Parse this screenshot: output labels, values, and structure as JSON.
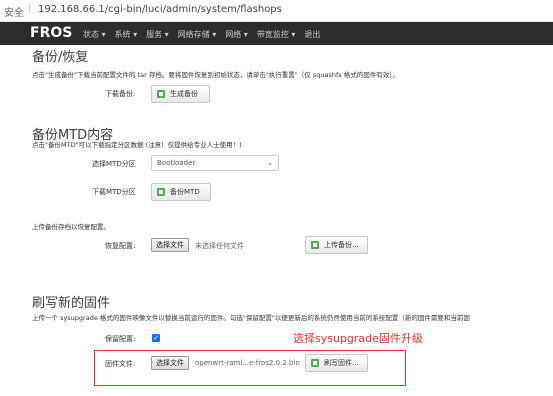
{
  "browser": {
    "security": "安全",
    "url": "192.168.66.1/cgi-bin/luci/admin/system/flashops"
  },
  "nav": {
    "brand": "FROS",
    "items": [
      "状态 ▾",
      "系统 ▾",
      "服务 ▾",
      "网络存储 ▾",
      "网络 ▾",
      "带宽监控 ▾",
      "退出"
    ]
  },
  "backup": {
    "title": "备份/恢复",
    "desc": "点击\"生成备份\"下载当前配置文件的 tar 存档。要将固件恢复到初始状态，请单击\"执行重置\"（仅 squashfs 格式的固件有效）。",
    "download_label": "下载备份:",
    "generate_btn": "生成备份"
  },
  "mtd": {
    "title": "备份MTD内容",
    "desc": "点击\"备份MTD\"可以下载指定分区数据 (注意！仅提供给专业人士使用！)",
    "select_label": "选择MTD分区",
    "select_value": "Bootloader",
    "download_label": "下载MTD分区",
    "backup_btn": "备份MTD"
  },
  "restore": {
    "desc": "上传备份存档以恢复配置。",
    "label": "恢复配置:",
    "choose_btn": "选择文件",
    "no_file": "未选择任何文件",
    "upload_btn": "上传备份..."
  },
  "flash": {
    "title": "刷写新的固件",
    "desc": "上传一个 sysupgrade 格式的固件映像文件以替换当前运行的固件。勾选\"保留配置\"以便更新后的系统仍然使用当前的系统配置（新的固件需要和当前固",
    "keep_label": "保留配置:",
    "keep_checked": "✓",
    "note": "选择sysupgrade固件升级",
    "file_label": "固件文件:",
    "choose_btn": "选择文件",
    "file_name": "openwrt-rami...e-fros2.0.2.bin",
    "flash_btn": "刷写固件..."
  }
}
